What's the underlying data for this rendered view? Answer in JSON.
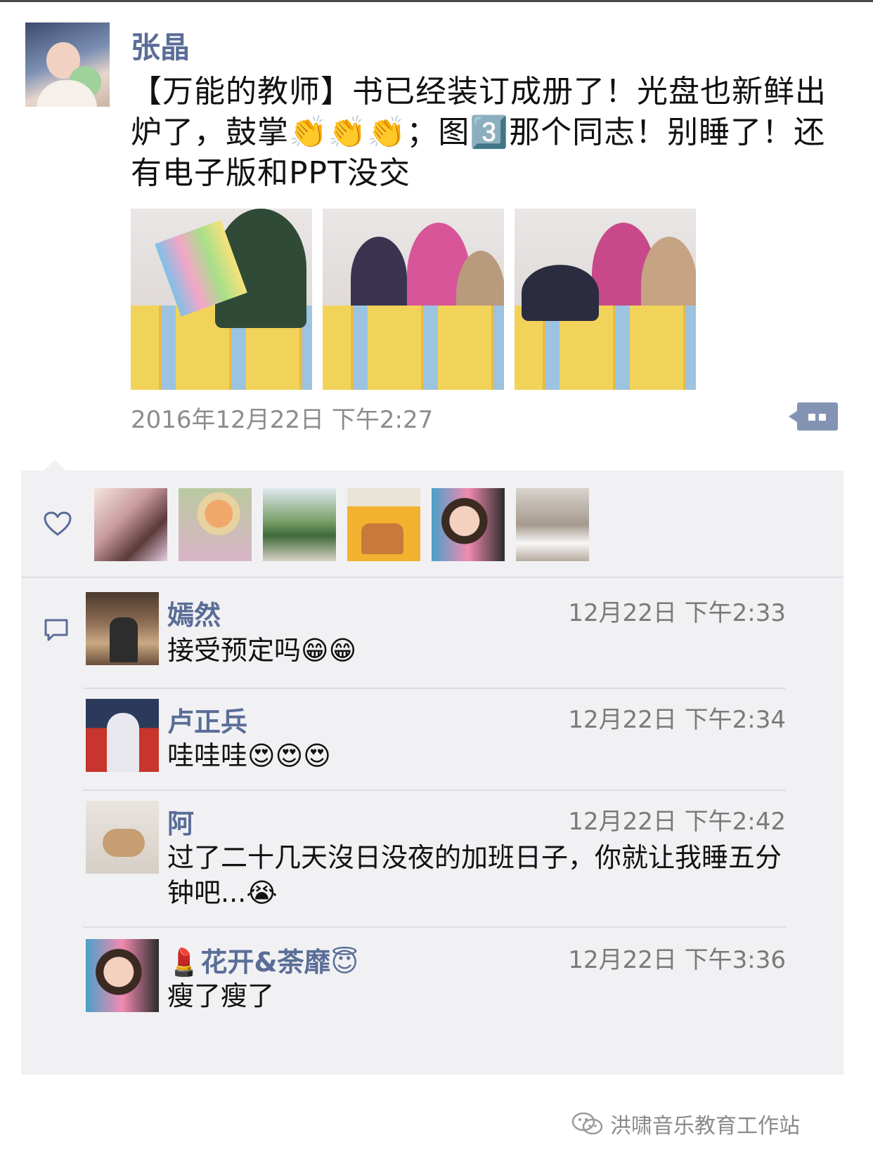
{
  "post": {
    "author": "张晶",
    "text": "【万能的教师】书已经装订成册了！光盘也新鲜出炉了，鼓掌👏👏👏；图3️⃣那个同志！别睡了！还有电子版和PPT没交",
    "time": "2016年12月22日 下午2:27",
    "photos": [
      "photo-1",
      "photo-2",
      "photo-3"
    ]
  },
  "likes": {
    "icon": "heart-icon",
    "avatar_count": 6
  },
  "comments": [
    {
      "name": "嫣然",
      "time": "12月22日 下午2:33",
      "text": "接受预定吗😁😁"
    },
    {
      "name": "卢正兵",
      "time": "12月22日 下午2:34",
      "text": "哇哇哇😍😍😍"
    },
    {
      "name": "阿",
      "time": "12月22日 下午2:42",
      "text": "过了二十几天沒日没夜的加班日子，你就让我睡五分钟吧...😭"
    },
    {
      "name": "💄花开&荼靡😇",
      "time": "12月22日 下午3:36",
      "text": "瘦了瘦了"
    }
  ],
  "watermark": {
    "text": "洪啸音乐教育工作站",
    "icon": "wechat-icon"
  },
  "colors": {
    "name_link": "#5a6d97",
    "panel_bg": "#f1f1f4",
    "time_gray": "#8c8c8c"
  }
}
